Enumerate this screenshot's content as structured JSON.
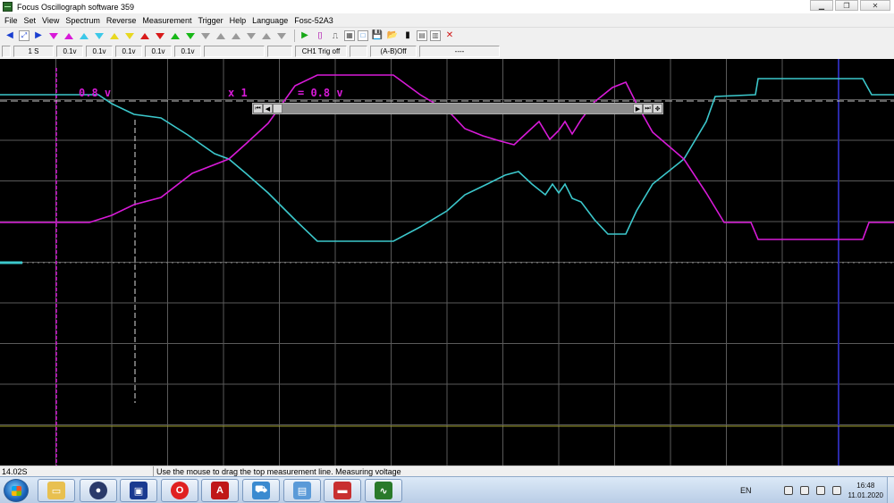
{
  "window": {
    "title": "Focus Oscillograph software 359",
    "minimize_icon": "minimize-icon",
    "maximize_icon": "restore-icon",
    "close_icon": "close-icon"
  },
  "menu": [
    "File",
    "Set",
    "View",
    "Spectrum",
    "Reverse",
    "Measurement",
    "Trigger",
    "Help",
    "Language",
    "Fosc-52A3"
  ],
  "toolbar": {
    "close_glyph": "✕",
    "icons": [
      "arrow-left-icon",
      "fit-icon",
      "arrow-right-icon",
      "magenta-up-icon",
      "magenta-down-icon",
      "cyan-up-icon",
      "cyan-down-icon",
      "yellow-up-icon",
      "yellow-down-icon",
      "red-up-icon",
      "red-down-icon",
      "green-up-icon",
      "green-down-icon",
      "gray-up-icon",
      "gray-down-icon",
      "run-icon",
      "single-icon",
      "pulse-icon",
      "grid-icon",
      "new-icon",
      "save-icon",
      "open-icon",
      "screen-icon",
      "print-icon",
      "info-icon",
      "stop-icon"
    ]
  },
  "status": {
    "timebase": "1 S",
    "ch_scales": [
      "0.1v",
      "0.1v",
      "0.1v",
      "0.1v",
      "0.1v"
    ],
    "trigger": "CH1 Trig off",
    "math": "(A-B)Off",
    "extra": "----"
  },
  "scope": {
    "colors": {
      "ch1": "#d81ad8",
      "ch2": "#3cc8cc",
      "grid": "#5a5a5a",
      "marker": "#2a2aa8",
      "ground": "#9b9b2a"
    },
    "label_volts": "0.8 v",
    "label_probe": "x 1",
    "label_offset": "= 0.8 v"
  },
  "bottom": {
    "time": "14.02S",
    "message": "Use the mouse to drag the top measurement line. Measuring voltage"
  },
  "taskbar": {
    "apps": [
      "explorer-icon",
      "media-player-icon",
      "save-app-icon",
      "opera-icon",
      "pdf-icon",
      "car-app-icon",
      "network-app-icon",
      "toolbox-icon",
      "oscillograph-icon"
    ],
    "lang": "EN",
    "time": "16:48",
    "date": "11.01.2020"
  }
}
